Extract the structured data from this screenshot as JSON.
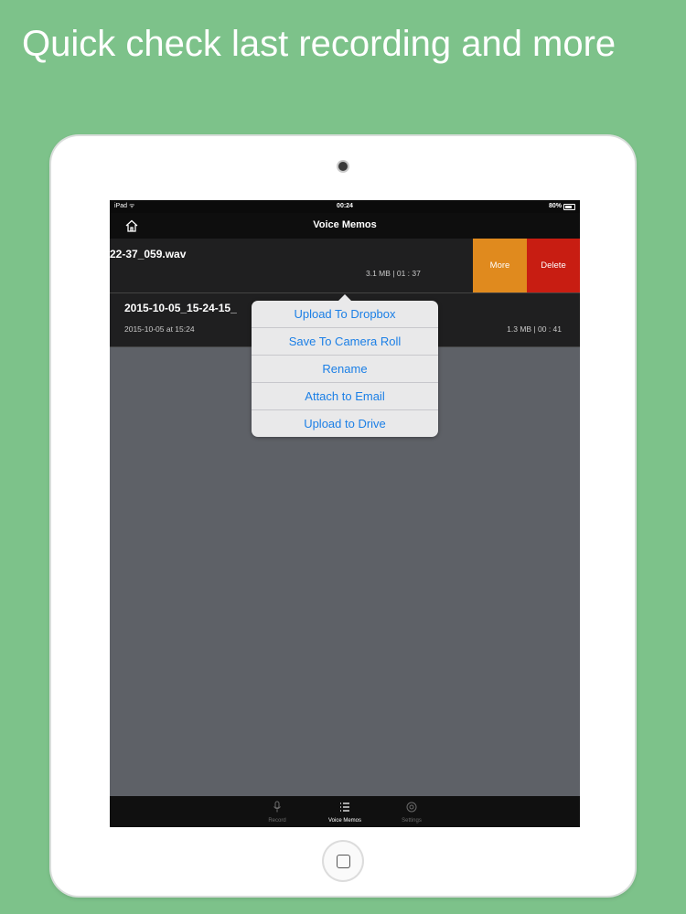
{
  "headline": "Quick check last recording and more",
  "status_bar": {
    "device": "iPad",
    "time": "00:24",
    "battery": "80%"
  },
  "nav": {
    "title": "Voice Memos"
  },
  "recordings": [
    {
      "name": "22-37_059.wav",
      "meta": "3.1 MB | 01 : 37"
    },
    {
      "name": "2015-10-05_15-24-15_",
      "date": "2015-10-05 at 15:24",
      "meta": "1.3 MB | 00 : 41"
    }
  ],
  "swipe_actions": {
    "more": "More",
    "delete": "Delete"
  },
  "menu": [
    "Upload To Dropbox",
    "Save To Camera Roll",
    "Rename",
    "Attach to Email",
    "Upload to Drive"
  ],
  "tabs": [
    {
      "label": "Record",
      "icon": "microphone-icon"
    },
    {
      "label": "Voice Memos",
      "icon": "list-icon"
    },
    {
      "label": "Settings",
      "icon": "gear-icon"
    }
  ],
  "colors": {
    "background": "#7dc28a",
    "more": "#e08a1e",
    "delete": "#c81d12",
    "link": "#1b7fe6"
  }
}
